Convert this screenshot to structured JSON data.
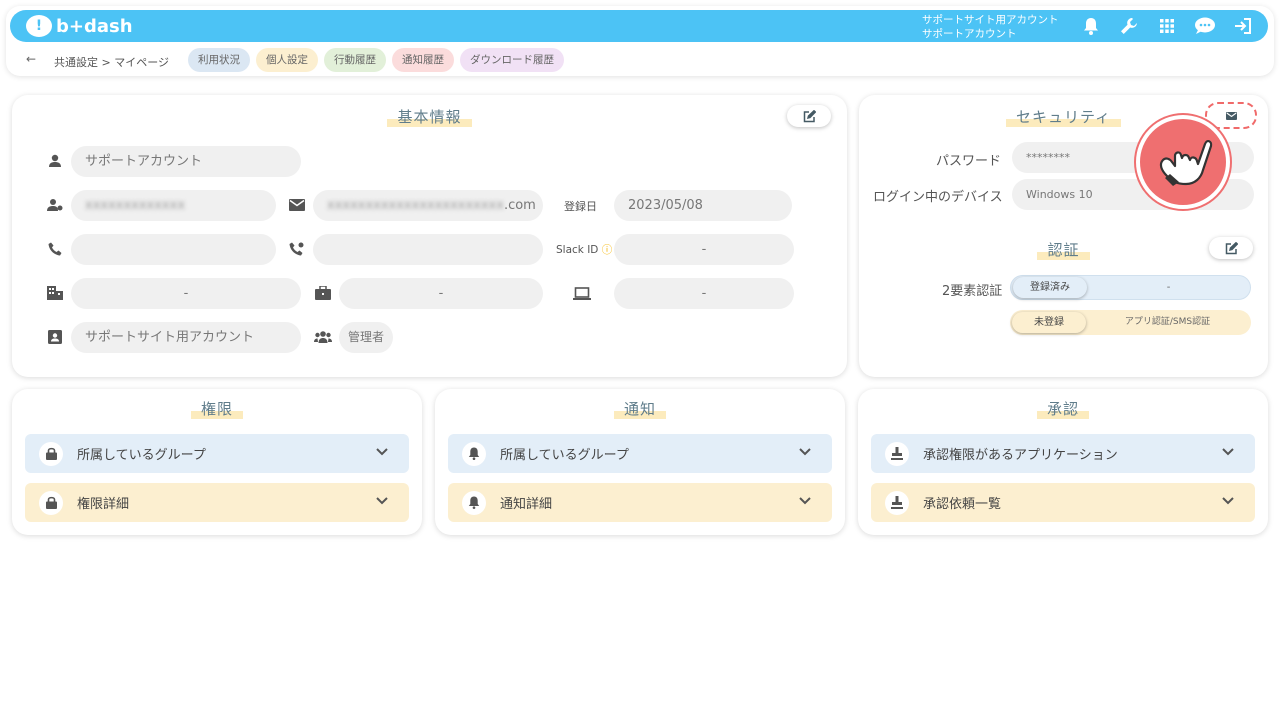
{
  "header": {
    "logo_text": "b+dash",
    "account_line1": "サポートサイト用アカウント",
    "account_line2": "サポートアカウント",
    "icons": [
      "bell-icon",
      "wrench-icon",
      "grid-icon",
      "chat-icon",
      "logout-icon"
    ]
  },
  "subnav": {
    "back": "←",
    "breadcrumb": "共通設定 > マイページ",
    "tabs": [
      {
        "label": "利用状況",
        "color": "#dbe7f3"
      },
      {
        "label": "個人設定",
        "color": "#fcefd0"
      },
      {
        "label": "行動履歴",
        "color": "#e2f0d9"
      },
      {
        "label": "通知履歴",
        "color": "#fbdcdc"
      },
      {
        "label": "ダウンロード履歴",
        "color": "#f1e1f5"
      }
    ]
  },
  "basic": {
    "title": "基本情報",
    "name": "サポートアカウント",
    "user_id": "xxxxxxxxxxxxx",
    "email_blur": "xxxxxxxxxxxxxxxxxxxxxxx",
    "email_suffix": ".com",
    "registered_label": "登録日",
    "registered_value": "2023/05/08",
    "slack_label": "Slack ID",
    "slack_value": "-",
    "office_value": "-",
    "department_value": "-",
    "device_value": "-",
    "account_type": "サポートサイト用アカウント",
    "role": "管理者"
  },
  "security": {
    "title": "セキュリティ",
    "password_label": "パスワード",
    "password_value": "********",
    "device_label": "ログイン中のデバイス",
    "device_value": "Windows 10",
    "auth_title": "認証",
    "twofa_label": "2要素認証",
    "registered_badge": "登録済み",
    "registered_value": "-",
    "unregistered_badge": "未登録",
    "unregistered_value": "アプリ認証/SMS認証"
  },
  "permissions": {
    "title": "権限",
    "item1": "所属しているグループ",
    "item2": "権限詳細"
  },
  "notifications": {
    "title": "通知",
    "item1": "所属しているグループ",
    "item2": "通知詳細"
  },
  "approval": {
    "title": "承認",
    "item1": "承認権限があるアプリケーション",
    "item2": "承認依頼一覧"
  }
}
